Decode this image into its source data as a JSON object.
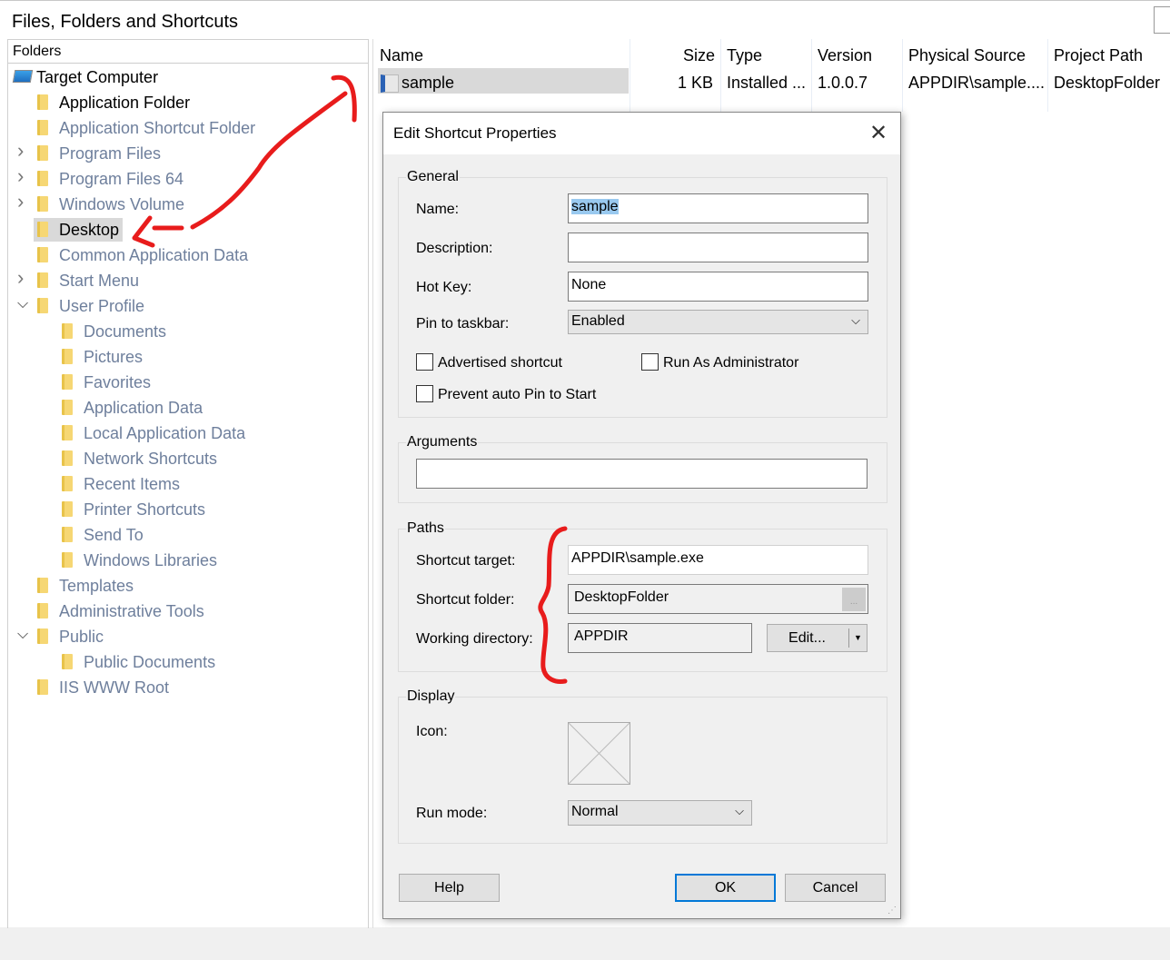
{
  "window": {
    "title": "Files, Folders and Shortcuts"
  },
  "tree": {
    "header": "Folders",
    "items": [
      {
        "label": "Target Computer",
        "level": 0,
        "icon": "computer-icon",
        "dark": true
      },
      {
        "label": "Application Folder",
        "level": 1,
        "dark": true
      },
      {
        "label": "Application Shortcut Folder",
        "level": 1
      },
      {
        "label": "Program Files",
        "level": 1,
        "expander": "collapsed"
      },
      {
        "label": "Program Files 64",
        "level": 1,
        "expander": "collapsed"
      },
      {
        "label": "Windows Volume",
        "level": 1,
        "expander": "collapsed"
      },
      {
        "label": "Desktop",
        "level": 1,
        "dark": true,
        "selected": true
      },
      {
        "label": "Common Application Data",
        "level": 1
      },
      {
        "label": "Start Menu",
        "level": 1,
        "expander": "collapsed"
      },
      {
        "label": "User Profile",
        "level": 1,
        "expander": "expanded"
      },
      {
        "label": "Documents",
        "level": 2
      },
      {
        "label": "Pictures",
        "level": 2
      },
      {
        "label": "Favorites",
        "level": 2
      },
      {
        "label": "Application Data",
        "level": 2
      },
      {
        "label": "Local Application Data",
        "level": 2
      },
      {
        "label": "Network Shortcuts",
        "level": 2
      },
      {
        "label": "Recent Items",
        "level": 2
      },
      {
        "label": "Printer Shortcuts",
        "level": 2
      },
      {
        "label": "Send To",
        "level": 2
      },
      {
        "label": "Windows Libraries",
        "level": 2
      },
      {
        "label": "Templates",
        "level": 1
      },
      {
        "label": "Administrative Tools",
        "level": 1
      },
      {
        "label": "Public",
        "level": 1,
        "expander": "expanded"
      },
      {
        "label": "Public Documents",
        "level": 2
      },
      {
        "label": "IIS WWW Root",
        "level": 1
      }
    ]
  },
  "list": {
    "columns": [
      "Name",
      "Size",
      "Type",
      "Version",
      "Physical Source",
      "Project Path"
    ],
    "rows": [
      [
        "sample",
        "1 KB",
        "Installed ...",
        "1.0.0.7",
        "APPDIR\\sample....",
        "DesktopFolder"
      ]
    ]
  },
  "dialog": {
    "title": "Edit Shortcut Properties",
    "general": {
      "label": "General",
      "name_label": "Name:",
      "name_value": "sample",
      "description_label": "Description:",
      "description_value": "",
      "hotkey_label": "Hot Key:",
      "hotkey_value": "None",
      "pin_label": "Pin to taskbar:",
      "pin_value": "Enabled",
      "advertised": "Advertised shortcut",
      "run_admin": "Run As Administrator",
      "prevent_pin": "Prevent auto Pin to Start"
    },
    "arguments": {
      "label": "Arguments",
      "value": ""
    },
    "paths": {
      "label": "Paths",
      "target_label": "Shortcut target:",
      "target_value": "APPDIR\\sample.exe",
      "folder_label": "Shortcut folder:",
      "folder_value": "DesktopFolder",
      "browse": "...",
      "workdir_label": "Working directory:",
      "workdir_value": "APPDIR",
      "edit_button": "Edit..."
    },
    "display": {
      "label": "Display",
      "icon_label": "Icon:",
      "runmode_label": "Run mode:",
      "runmode_value": "Normal"
    },
    "buttons": {
      "help": "Help",
      "ok": "OK",
      "cancel": "Cancel"
    }
  },
  "colors": {
    "annotation": "#e81c1c",
    "selection": "#d9d9d9",
    "name_highlight": "#99c9ef",
    "tree_muted_text": "#6e7f9c"
  }
}
